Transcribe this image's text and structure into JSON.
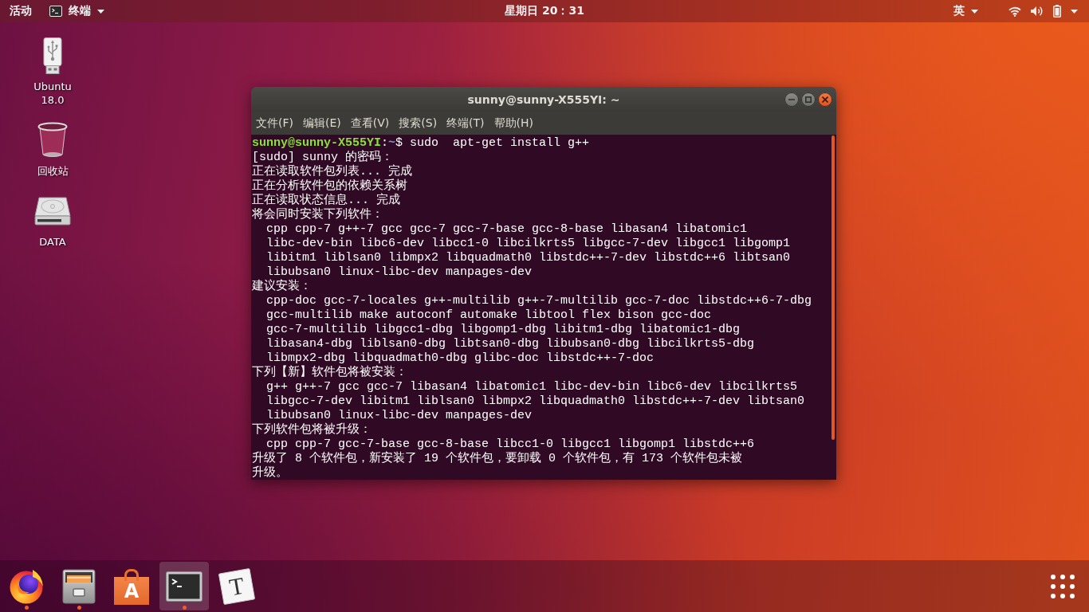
{
  "top_bar": {
    "activities": "活动",
    "app_menu": {
      "label": "终端"
    },
    "clock": "星期日 20：31",
    "input_method": {
      "label": "英"
    }
  },
  "desktop": {
    "items": [
      {
        "kind": "usb-drive",
        "label": "Ubuntu 18.0"
      },
      {
        "kind": "trash",
        "label": "回收站"
      },
      {
        "kind": "hard-disk",
        "label": "DATA"
      }
    ]
  },
  "terminal": {
    "title": "sunny@sunny-X555YI: ~",
    "menu": [
      "文件(F)",
      "编辑(E)",
      "查看(V)",
      "搜索(S)",
      "终端(T)",
      "帮助(H)"
    ],
    "lines": [
      {
        "kind": "prompt",
        "user": "sunny@sunny-X555YI",
        "separator": ":",
        "path": "~",
        "symbol": "$",
        "command": "sudo  apt-get install g++"
      },
      {
        "kind": "plain",
        "text": "[sudo] sunny 的密码："
      },
      {
        "kind": "plain",
        "text": "正在读取软件包列表... 完成"
      },
      {
        "kind": "plain",
        "text": "正在分析软件包的依赖关系树"
      },
      {
        "kind": "plain",
        "text": "正在读取状态信息... 完成"
      },
      {
        "kind": "plain",
        "text": "将会同时安装下列软件："
      },
      {
        "kind": "indented",
        "text": "cpp cpp-7 g++-7 gcc gcc-7 gcc-7-base gcc-8-base libasan4 libatomic1"
      },
      {
        "kind": "indented",
        "text": "libc-dev-bin libc6-dev libcc1-0 libcilkrts5 libgcc-7-dev libgcc1 libgomp1"
      },
      {
        "kind": "indented",
        "text": "libitm1 liblsan0 libmpx2 libquadmath0 libstdc++-7-dev libstdc++6 libtsan0"
      },
      {
        "kind": "indented",
        "text": "libubsan0 linux-libc-dev manpages-dev"
      },
      {
        "kind": "plain",
        "text": "建议安装："
      },
      {
        "kind": "indented",
        "text": "cpp-doc gcc-7-locales g++-multilib g++-7-multilib gcc-7-doc libstdc++6-7-dbg"
      },
      {
        "kind": "indented",
        "text": "gcc-multilib make autoconf automake libtool flex bison gcc-doc"
      },
      {
        "kind": "indented",
        "text": "gcc-7-multilib libgcc1-dbg libgomp1-dbg libitm1-dbg libatomic1-dbg"
      },
      {
        "kind": "indented",
        "text": "libasan4-dbg liblsan0-dbg libtsan0-dbg libubsan0-dbg libcilkrts5-dbg"
      },
      {
        "kind": "indented",
        "text": "libmpx2-dbg libquadmath0-dbg glibc-doc libstdc++-7-doc"
      },
      {
        "kind": "plain",
        "text": "下列【新】软件包将被安装："
      },
      {
        "kind": "indented",
        "text": "g++ g++-7 gcc gcc-7 libasan4 libatomic1 libc-dev-bin libc6-dev libcilkrts5"
      },
      {
        "kind": "indented",
        "text": "libgcc-7-dev libitm1 liblsan0 libmpx2 libquadmath0 libstdc++-7-dev libtsan0"
      },
      {
        "kind": "indented",
        "text": "libubsan0 linux-libc-dev manpages-dev"
      },
      {
        "kind": "plain",
        "text": "下列软件包将被升级："
      },
      {
        "kind": "indented",
        "text": "cpp cpp-7 gcc-7-base gcc-8-base libcc1-0 libgcc1 libgomp1 libstdc++6"
      },
      {
        "kind": "plain",
        "text": "升级了 8 个软件包，新安装了 19 个软件包，要卸载 0 个软件包，有 173 个软件包未被"
      },
      {
        "kind": "plain",
        "text": "升级。"
      }
    ]
  },
  "dock": {
    "items": [
      {
        "kind": "browser",
        "running": true,
        "selected": false
      },
      {
        "kind": "files",
        "running": true,
        "selected": false
      },
      {
        "kind": "software",
        "glyph": "A",
        "running": false,
        "selected": false
      },
      {
        "kind": "terminal",
        "running": true,
        "selected": true
      },
      {
        "kind": "text-editor",
        "glyph": "T",
        "running": false,
        "selected": false
      }
    ]
  }
}
